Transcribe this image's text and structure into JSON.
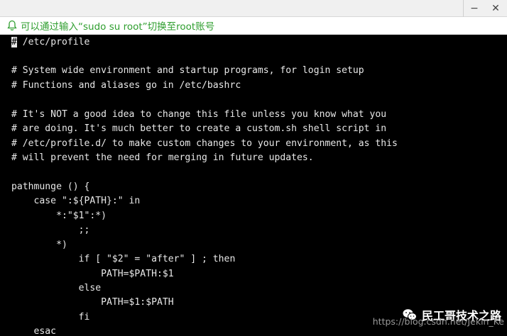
{
  "window": {
    "minimize_symbol": "−",
    "close_symbol": "✕"
  },
  "notice": {
    "icon": "bell-icon",
    "text": "可以通过输入“sudo su root”切换至root账号",
    "color": "#2e9e2e"
  },
  "terminal": {
    "cursor_char": "#",
    "lines": [
      " /etc/profile",
      "",
      "# System wide environment and startup programs, for login setup",
      "# Functions and aliases go in /etc/bashrc",
      "",
      "# It's NOT a good idea to change this file unless you know what you",
      "# are doing. It's much better to create a custom.sh shell script in",
      "# /etc/profile.d/ to make custom changes to your environment, as this",
      "# will prevent the need for merging in future updates.",
      "",
      "pathmunge () {",
      "    case \":${PATH}:\" in",
      "        *:\"$1\":*)",
      "            ;;",
      "        *)",
      "            if [ \"$2\" = \"after\" ] ; then",
      "                PATH=$PATH:$1",
      "            else",
      "                PATH=$1:$PATH",
      "            fi",
      "    esac"
    ]
  },
  "watermark": {
    "brand": "民工哥技术之路",
    "url": "https://blog.csdn.net/Jekin_Ke"
  }
}
